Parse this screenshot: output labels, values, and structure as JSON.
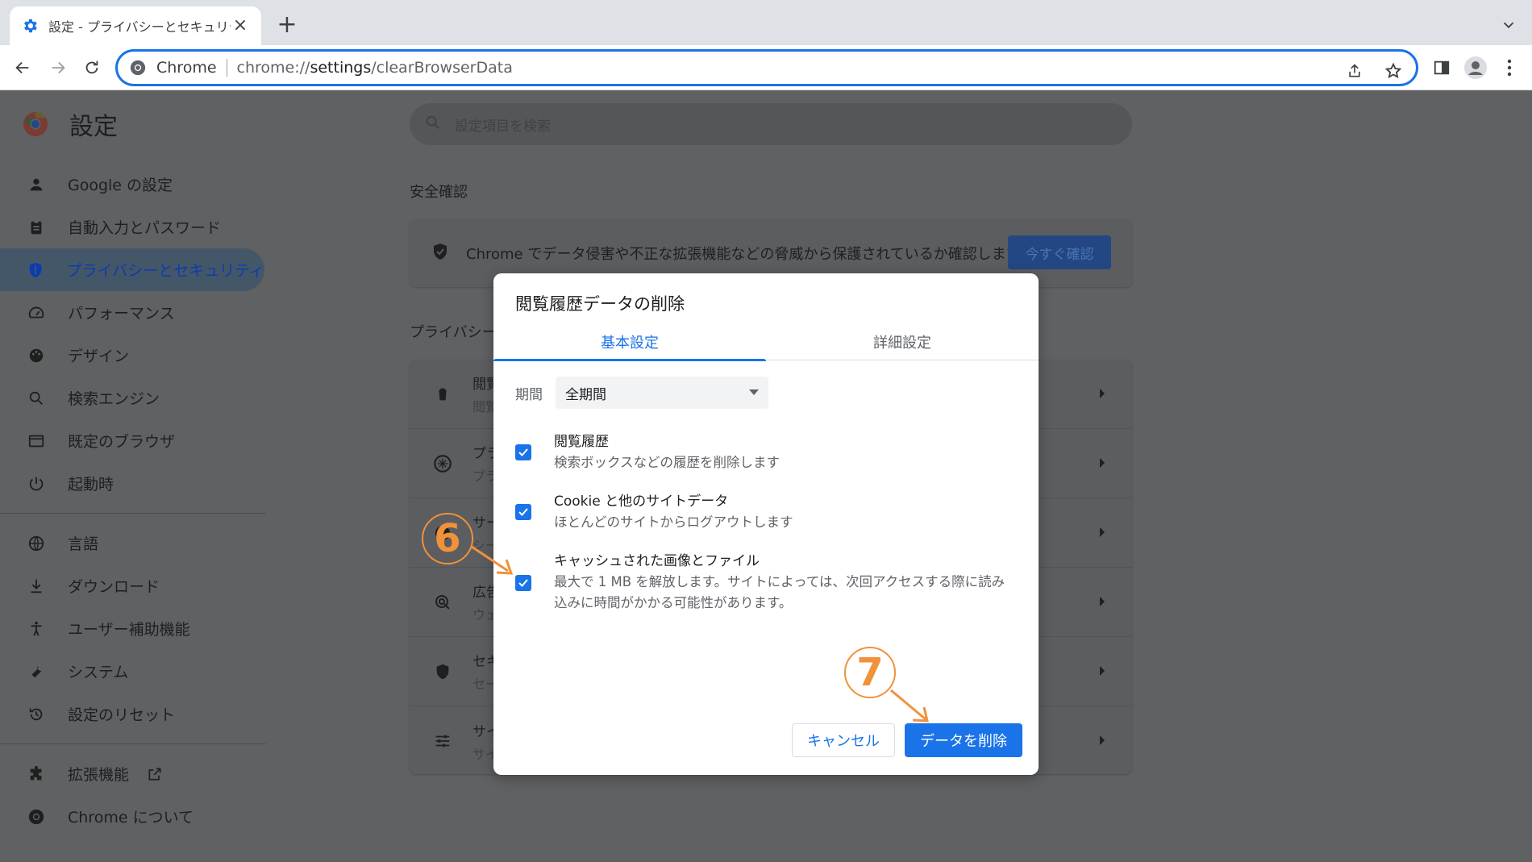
{
  "browser": {
    "tab_title": "設定 - プライバシーとセキュリテ",
    "omnibox_chip": "Chrome",
    "url_prefix": "chrome://",
    "url_host": "settings",
    "url_path": "/clearBrowserData"
  },
  "settings": {
    "title": "設定",
    "search_placeholder": "設定項目を検索",
    "sidebar": [
      {
        "label": "Google の設定",
        "icon": "person-icon"
      },
      {
        "label": "自動入力とパスワード",
        "icon": "clipboard-icon"
      },
      {
        "label": "プライバシーとセキュリティ",
        "icon": "shield-icon",
        "active": true
      },
      {
        "label": "パフォーマンス",
        "icon": "speedometer-icon"
      },
      {
        "label": "デザイン",
        "icon": "palette-icon"
      },
      {
        "label": "検索エンジン",
        "icon": "search-icon"
      },
      {
        "label": "既定のブラウザ",
        "icon": "browser-icon"
      },
      {
        "label": "起動時",
        "icon": "power-icon"
      },
      {
        "label": "言語",
        "icon": "globe-icon"
      },
      {
        "label": "ダウンロード",
        "icon": "download-icon"
      },
      {
        "label": "ユーザー補助機能",
        "icon": "accessibility-icon"
      },
      {
        "label": "システム",
        "icon": "wrench-icon"
      },
      {
        "label": "設定のリセット",
        "icon": "history-icon"
      },
      {
        "label": "拡張機能",
        "icon": "puzzle-icon"
      },
      {
        "label": "Chrome について",
        "icon": "chrome-icon"
      }
    ],
    "safety_title": "安全確認",
    "safety_text": "Chrome でデータ侵害や不正な拡張機能などの脅威から保護されているか確認します",
    "safety_button": "今すぐ確認",
    "privacy_title": "プライバシー",
    "privacy_rows": [
      {
        "title": "閲覧",
        "sub": "閲覧"
      },
      {
        "title": "プラ",
        "sub": "プラ"
      },
      {
        "title": "サー",
        "sub": "シー"
      },
      {
        "title": "広告",
        "sub": "ウェ"
      },
      {
        "title": "セキ",
        "sub": "セー"
      },
      {
        "title": "サイ",
        "sub": "サイ"
      }
    ]
  },
  "dialog": {
    "title": "閲覧履歴データの削除",
    "tabs": [
      "基本設定",
      "詳細設定"
    ],
    "period_label": "期間",
    "period_value": "全期間",
    "options": [
      {
        "title": "閲覧履歴",
        "sub": "検索ボックスなどの履歴を削除します",
        "checked": true
      },
      {
        "title": "Cookie と他のサイトデータ",
        "sub": "ほとんどのサイトからログアウトします",
        "checked": true
      },
      {
        "title": "キャッシュされた画像とファイル",
        "sub": "最大で 1 MB を解放します。サイトによっては、次回アクセスする際に読み込みに時間がかかる可能性があります。",
        "checked": true
      }
    ],
    "cancel_label": "キャンセル",
    "delete_label": "データを削除"
  },
  "annotations": {
    "step6": "6",
    "step7": "7",
    "color": "#f0923a"
  },
  "colors": {
    "accent": "#1a73e8",
    "scrim": "#5f6163"
  }
}
